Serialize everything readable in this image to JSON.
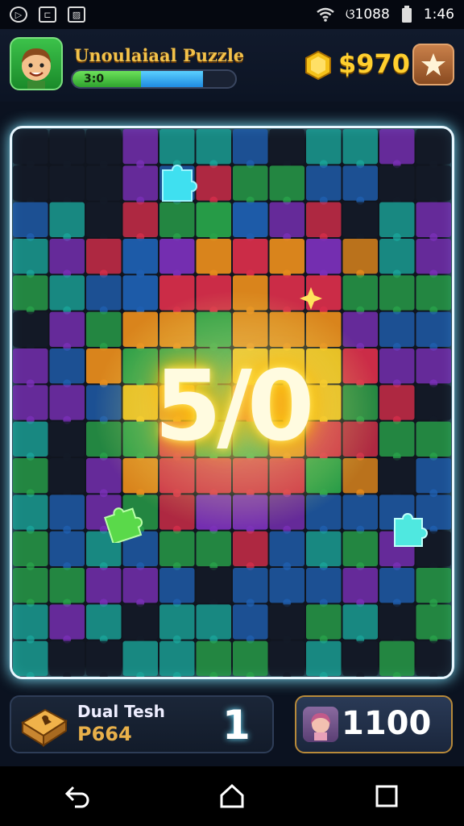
{
  "status_bar": {
    "right_text": "ଓ1088",
    "time": "1:46",
    "icons": [
      "app-notification-icon",
      "cast-icon",
      "image-icon",
      "wifi-icon",
      "battery-icon"
    ]
  },
  "header": {
    "title": "Unoulaiaal Puzzle",
    "xp_label": "3:0",
    "xp_progress_green": 0.42,
    "xp_progress_blue": 0.38,
    "coins": "$970",
    "coin_icon": "gold-coin-icon",
    "star_icon": "star-icon"
  },
  "board": {
    "score": "5/0",
    "colors": {
      "purple": "#7a2fb8",
      "blue": "#1f5fb0",
      "green": "#28a24a",
      "red": "#d62d4a",
      "orange": "#e58a1c",
      "yellow": "#f0c21e",
      "teal": "#1aa59a",
      "dark": "#141a28",
      "cyan": "#3fe0f0"
    }
  },
  "bottom": {
    "left_panel": {
      "title": "Dual Tesh",
      "code": "P664",
      "count": "1",
      "icon": "box-icon"
    },
    "right_panel": {
      "value": "1100",
      "icon": "player-avatar-icon"
    }
  },
  "nav": {
    "back_icon": "back-icon",
    "home_icon": "home-icon",
    "recents_icon": "recents-icon"
  }
}
